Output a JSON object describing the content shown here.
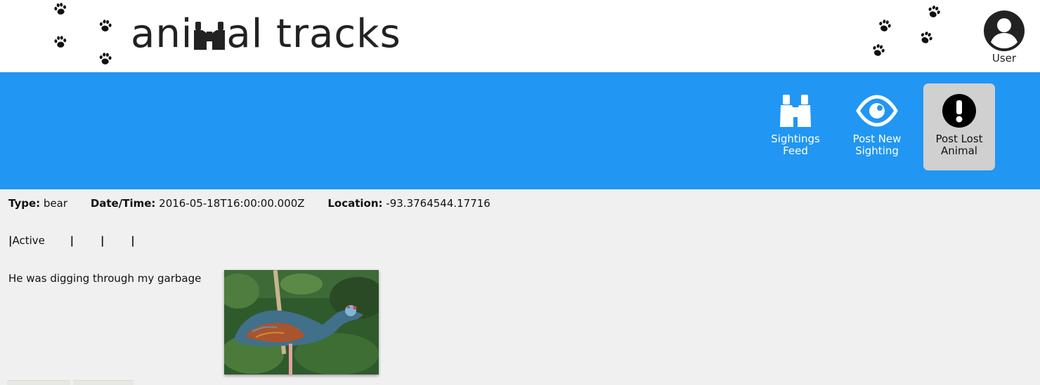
{
  "header": {
    "logo_text_before": "ani",
    "logo_text_after": "al tracks",
    "logo_icon": "binoculars-icon",
    "user_label": "User",
    "user_icon": "account-circle-icon",
    "decor_icon": "paw-icon"
  },
  "nav": {
    "items": [
      {
        "label_line1": "Sightings",
        "label_line2": "Feed",
        "icon": "binoculars-icon"
      },
      {
        "label_line1": "Post New",
        "label_line2": "Sighting",
        "icon": "eye-icon"
      },
      {
        "label_line1": "Post Lost",
        "label_line2": "Animal",
        "icon": "exclamation-circle-icon",
        "active": true
      }
    ]
  },
  "sighting": {
    "type_label": "Type:",
    "type_value": "bear",
    "datetime_label": "Date/Time:",
    "datetime_value": "2016-05-18T16:00:00.000Z",
    "location_label": "Location:",
    "location_value": "-93.3764544.17716",
    "status": "Active",
    "separator": "|",
    "description": "He was digging through my garbage"
  },
  "colors": {
    "navbar": "#2196f3",
    "active_nav": "#d0d0d0",
    "page_bg": "#f0f0f0",
    "header_bg": "#ffffff"
  }
}
